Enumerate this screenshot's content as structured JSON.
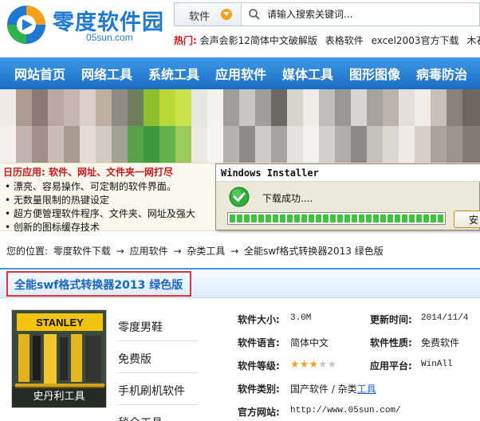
{
  "site": {
    "name": "零度软件园",
    "domain": "05sun.com"
  },
  "search": {
    "category": "软件",
    "placeholder": "请输入搜索关键词..."
  },
  "hot": {
    "label": "热门:",
    "links": [
      "会声会影12简体中文破解版",
      "表格软件",
      "excel2003官方下载",
      "木石"
    ]
  },
  "nav": {
    "items": [
      "网站首页",
      "网络工具",
      "系统工具",
      "应用软件",
      "媒体工具",
      "图形图像",
      "病毒防治"
    ]
  },
  "ad": {
    "title": "日历应用: 软件、网址、文件夹一网打尽",
    "lines": [
      "• 漂亮、容易操作、可定制的软件界面。",
      "• 无数量限制的热键设定",
      "• 超方便管理软件程序、文件夹、网址及强大",
      "• 创新的图标缓存技术"
    ]
  },
  "dialog": {
    "title": "Windows Installer",
    "message": "下载成功....",
    "progress": 1.0,
    "button": "安"
  },
  "breadcrumb": {
    "label": "您的位置:",
    "items": [
      "零度软件下载",
      "应用软件",
      "杂类工具",
      "全能swf格式转换器2013 绿色版"
    ],
    "separator": "→"
  },
  "page": {
    "title": "全能swf格式转换器2013 绿色版"
  },
  "thumb": {
    "caption": "史丹利工具",
    "brand": "STANLEY"
  },
  "related": [
    "零度男鞋",
    "免费版",
    "手机刷机软件",
    "毯全工具"
  ],
  "details": {
    "size_label": "软件大小:",
    "size": "3.0M",
    "updated_label": "更新时间:",
    "updated": "2014/11/4",
    "language_label": "软件语言:",
    "language": "简体中文",
    "license_label": "软件性质:",
    "license": "免费软件",
    "rating_label": "软件等级:",
    "rating": 3,
    "rating_max": 5,
    "platform_label": "应用平台:",
    "platform": "WinAll",
    "category_label": "软件类别:",
    "category": "国产软件 / 杂类",
    "category_link": "工具",
    "website_label": "官方网站:",
    "website": "http://www.05sun.com/"
  },
  "colors": {
    "brand": "#1f78d1",
    "nav": "#2a82d8",
    "hot": "#d4161c",
    "highlight_frame": "#e43232",
    "progress": "#3cc43c"
  }
}
